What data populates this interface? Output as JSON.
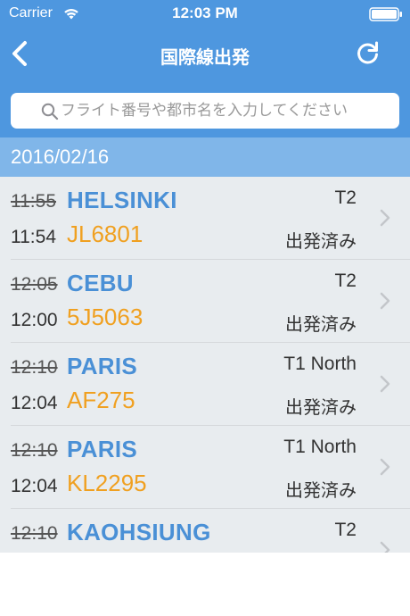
{
  "statusbar": {
    "carrier": "Carrier",
    "time": "12:03 PM"
  },
  "navbar": {
    "title": "国際線出発",
    "back_icon": "chevron-left-icon",
    "refresh_icon": "refresh-icon"
  },
  "search": {
    "placeholder": "フライト番号や都市名を入力してください",
    "value": ""
  },
  "date": "2016/02/16",
  "flights": [
    {
      "scheduled": "11:55",
      "actual": "11:54",
      "destination": "HELSINKI",
      "flight": "JL6801",
      "terminal": "T2",
      "status": "出発済み"
    },
    {
      "scheduled": "12:05",
      "actual": "12:00",
      "destination": "CEBU",
      "flight": "5J5063",
      "terminal": "T2",
      "status": "出発済み"
    },
    {
      "scheduled": "12:10",
      "actual": "12:04",
      "destination": "PARIS",
      "flight": "AF275",
      "terminal": "T1 North",
      "status": "出発済み"
    },
    {
      "scheduled": "12:10",
      "actual": "12:04",
      "destination": "PARIS",
      "flight": "KL2295",
      "terminal": "T1 North",
      "status": "出発済み"
    },
    {
      "scheduled": "12:10",
      "actual": "",
      "destination": "KAOHSIUNG",
      "flight": "",
      "terminal": "T2",
      "status": ""
    }
  ],
  "colors": {
    "header_blue": "#4e97df",
    "date_bar_blue": "#80b6e9",
    "destination_blue": "#4a90d6",
    "flight_orange": "#f0a020",
    "list_bg": "#e8ecef"
  }
}
